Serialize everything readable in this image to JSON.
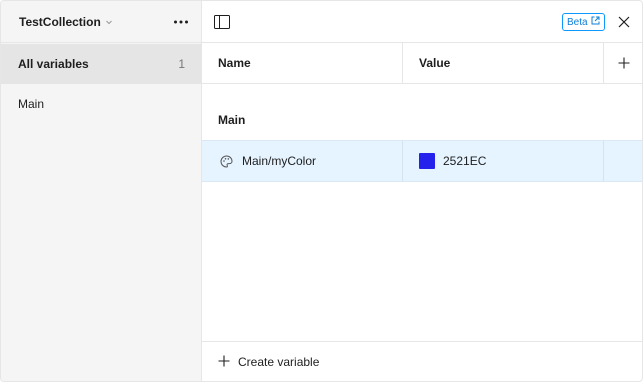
{
  "sidebar": {
    "collection_name": "TestCollection",
    "items": [
      {
        "label": "All variables",
        "count": "1"
      },
      {
        "label": "Main"
      }
    ]
  },
  "topbar": {
    "beta_label": "Beta"
  },
  "table": {
    "columns": [
      "Name",
      "Value"
    ],
    "group": "Main",
    "rows": [
      {
        "name": "Main/myColor",
        "value": "2521EC",
        "color": "#2521EC"
      }
    ]
  },
  "footer": {
    "create_label": "Create variable"
  },
  "colors": {
    "accent": "#0d99ff",
    "selected_row": "#e5f4ff"
  },
  "icons": [
    "chevron-down-icon",
    "more-icon",
    "panel-toggle-icon",
    "external-link-icon",
    "close-icon",
    "plus-icon",
    "palette-icon"
  ]
}
